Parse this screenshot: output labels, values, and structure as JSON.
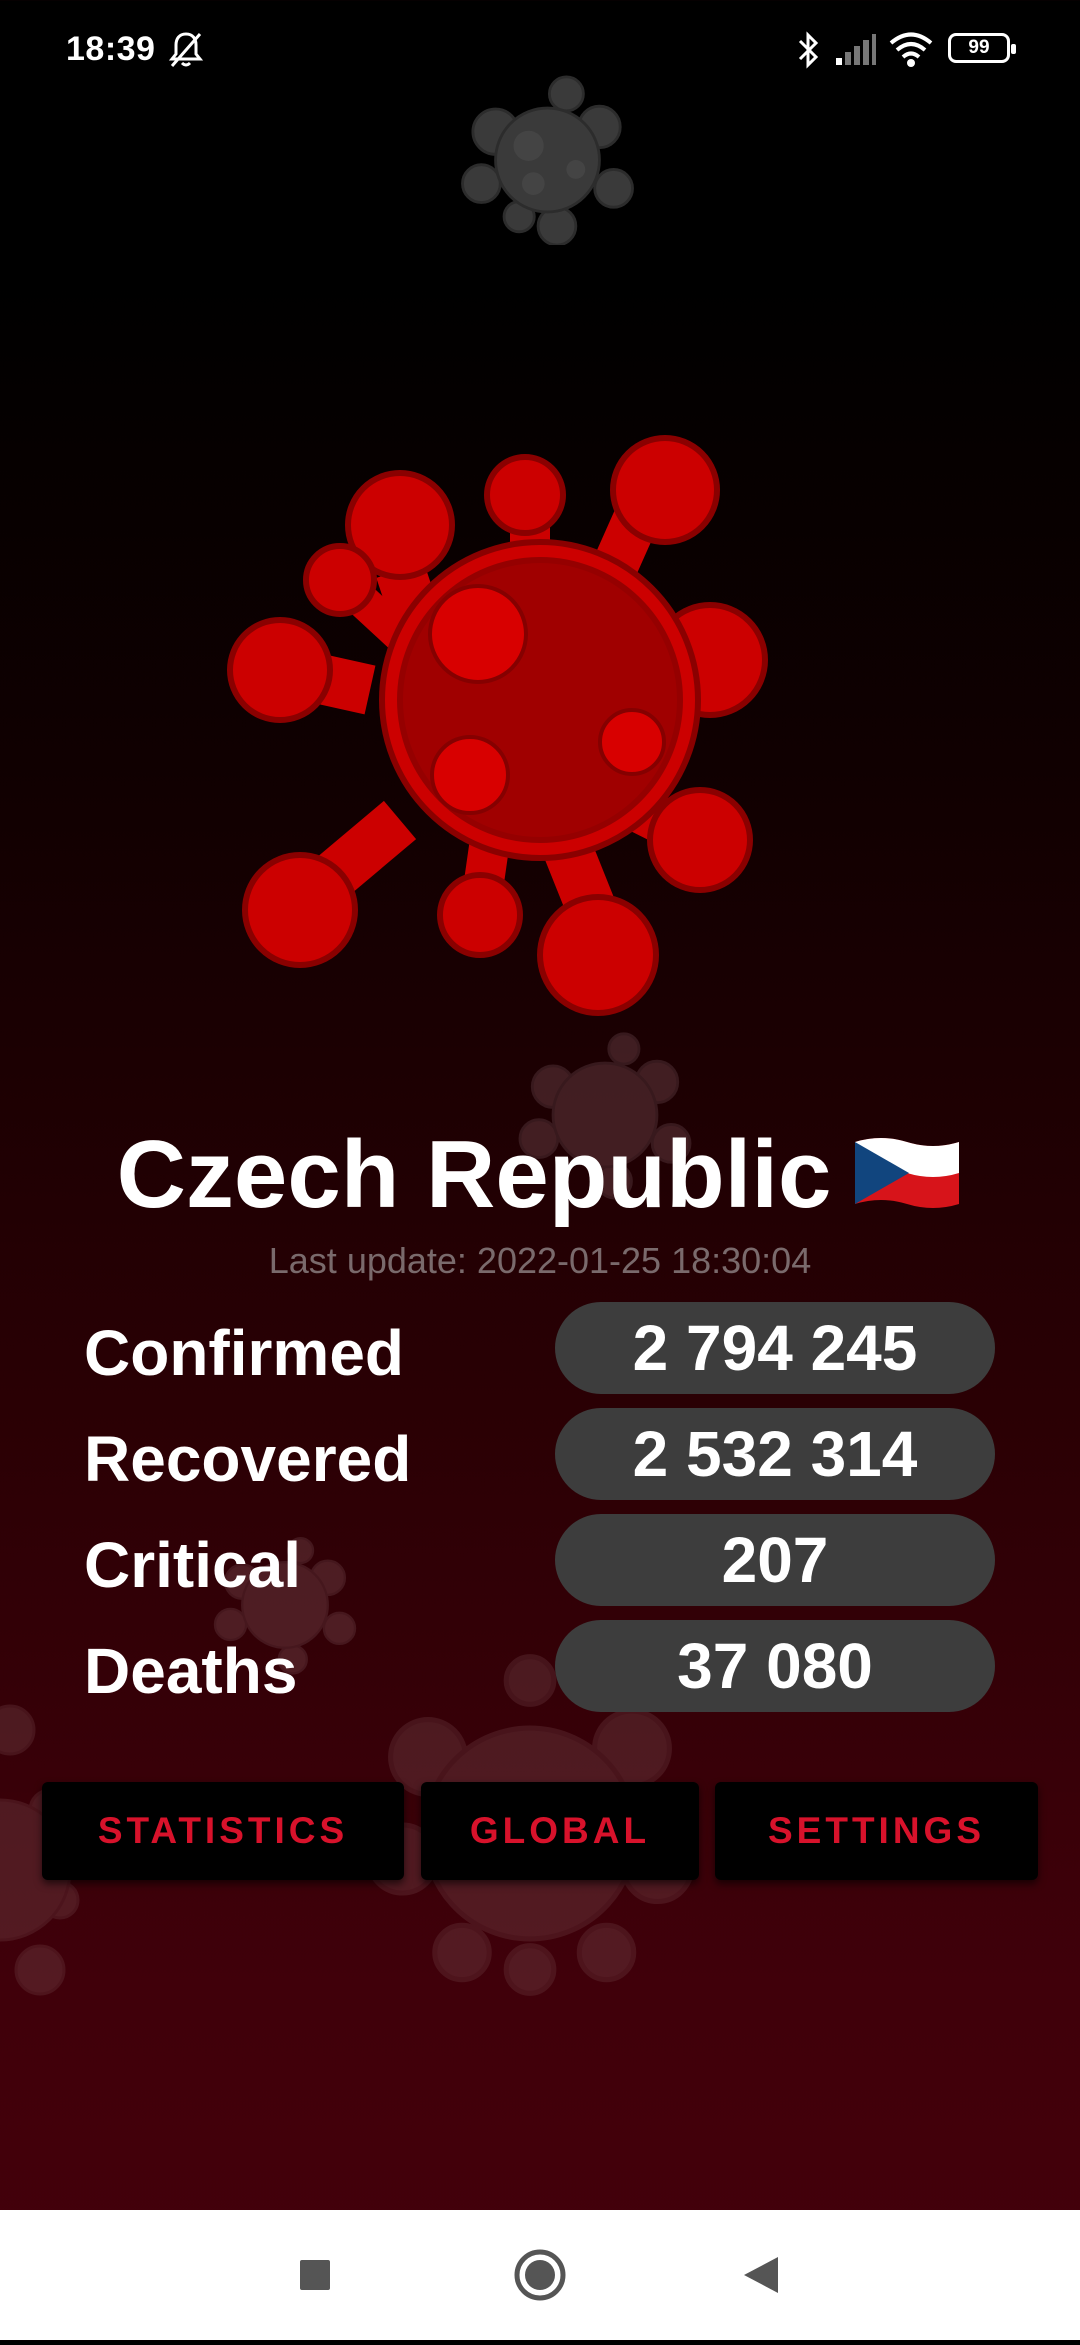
{
  "status_bar": {
    "time": "18:39",
    "battery": "99",
    "icons": [
      "bell-off-icon",
      "bluetooth-icon",
      "signal-icon",
      "wifi-icon",
      "battery-icon"
    ]
  },
  "main": {
    "country": "Czech Republic",
    "flag": "czech-flag",
    "last_update": "Last update: 2022-01-25 18:30:04",
    "stats": [
      {
        "label": "Confirmed",
        "value": "2 794 245"
      },
      {
        "label": "Recovered",
        "value": "2 532 314"
      },
      {
        "label": "Critical",
        "value": "207"
      },
      {
        "label": "Deaths",
        "value": "37 080"
      }
    ]
  },
  "buttons": {
    "statistics": "STATISTICS",
    "global": "GLOBAL",
    "settings": "SETTINGS"
  },
  "colors": {
    "accent": "#d8122b",
    "virus": "#cc0000",
    "pill": "#3d3d3d"
  },
  "nav": [
    "recents-square-icon",
    "home-circle-icon",
    "back-triangle-icon"
  ]
}
